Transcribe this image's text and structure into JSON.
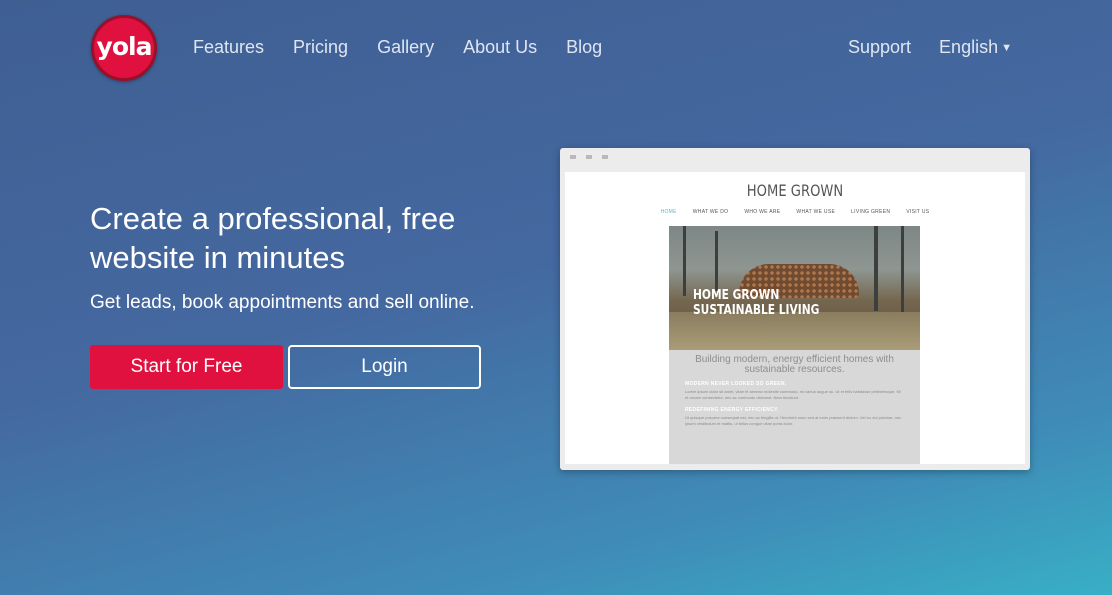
{
  "header": {
    "logo_text": "yola",
    "nav": [
      "Features",
      "Pricing",
      "Gallery",
      "About Us",
      "Blog"
    ],
    "support": "Support",
    "language": "English"
  },
  "hero": {
    "title": "Create a professional, free website in minutes",
    "subtitle": "Get leads, book appointments and sell online.",
    "start_button": "Start for Free",
    "login_button": "Login"
  },
  "preview": {
    "site_title": "HOME GROWN",
    "site_nav": [
      "HOME",
      "WHAT WE DO",
      "WHO WE ARE",
      "WHAT WE USE",
      "LIVING GREEN",
      "VISIT US"
    ],
    "hero_caption_line1": "HOME GROWN",
    "hero_caption_line2": "SUSTAINABLE LIVING",
    "tagline": "Building modern, energy efficient homes with sustainable resources.",
    "section1_heading": "MODERN NEVER LOOKED SO GREEN.",
    "section1_text": "Lorem ipsum dolor sit amet, vitae et aenean molestie commodo, mi varius augue ac. Ut et felis habitasse pellentesque. Mi et ornare consectetur, nec ac commodo dictumst. Nam tincidunt.",
    "section2_heading": "REDEFINING ENERGY EFFICIENCY.",
    "section2_text": "Ut quisque posuere consequat est, nec ac fringilla ut. Hendrerit nunc sed at enim praesent dictum. Vel eu dui pulvinar, nec ipsum vestibulum et mattis, ut tellus congue vitae porta dolor."
  }
}
